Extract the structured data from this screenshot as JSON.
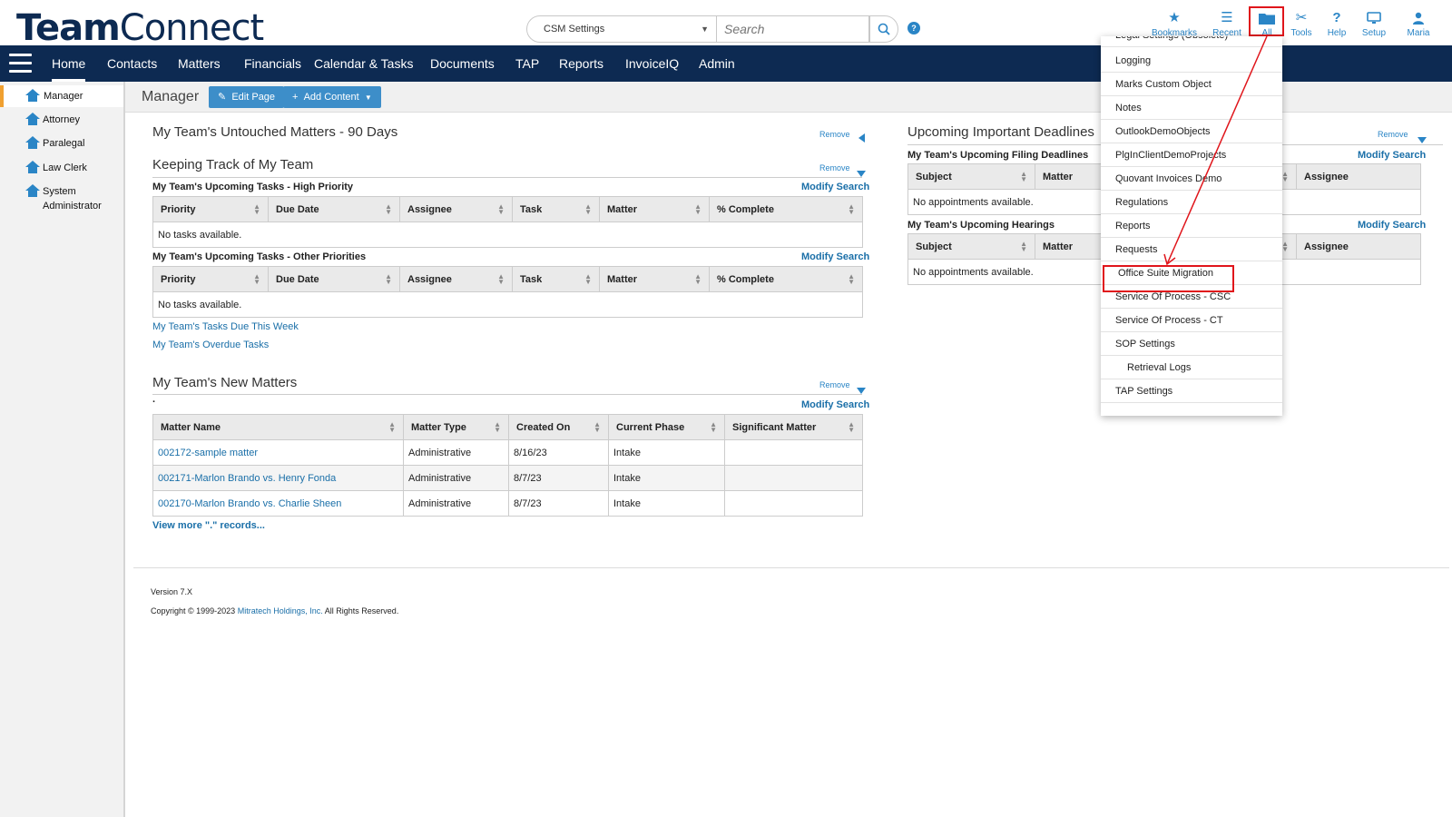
{
  "header": {
    "logo_bold": "Team",
    "logo_light": "Connect",
    "scope_select": "CSM Settings",
    "search_placeholder": "Search",
    "icons": [
      {
        "name": "bookmarks",
        "label": "Bookmarks",
        "icon": "star-icon"
      },
      {
        "name": "recent",
        "label": "Recent",
        "icon": "list-icon"
      },
      {
        "name": "all",
        "label": "All",
        "icon": "folder-icon"
      },
      {
        "name": "tools",
        "label": "Tools",
        "icon": "tools-icon"
      },
      {
        "name": "help",
        "label": "Help",
        "icon": "question-icon"
      },
      {
        "name": "setup",
        "label": "Setup",
        "icon": "monitor-icon"
      },
      {
        "name": "user",
        "label": "Maria",
        "icon": "user-icon"
      }
    ]
  },
  "nav": {
    "items": [
      "Home",
      "Contacts",
      "Matters",
      "Financials",
      "Calendar & Tasks",
      "Documents",
      "TAP",
      "Reports",
      "InvoiceIQ",
      "Admin"
    ]
  },
  "sidebar": {
    "items": [
      "Manager",
      "Attorney",
      "Paralegal",
      "Law Clerk",
      "System Administrator"
    ]
  },
  "pagebar": {
    "title": "Manager",
    "edit_label": "Edit Page",
    "add_label": "Add Content"
  },
  "left": {
    "untouched_title": "My Team's Untouched Matters - 90 Days",
    "remove": "Remove",
    "keeping_title": "Keeping Track of My Team",
    "high_title": "My Team's Upcoming Tasks - High Priority",
    "other_title": "My Team's Upcoming Tasks - Other Priorities",
    "modify": "Modify Search",
    "task_cols": [
      "Priority",
      "Due Date",
      "Assignee",
      "Task",
      "Matter",
      "% Complete"
    ],
    "no_tasks": "No tasks available.",
    "due_week": "My Team's Tasks Due This Week",
    "overdue": "My Team's Overdue Tasks",
    "new_matters_title": "My Team's New Matters",
    "dot": ".",
    "matter_cols": [
      "Matter Name",
      "Matter Type",
      "Created On",
      "Current Phase",
      "Significant Matter"
    ],
    "matters": [
      {
        "name": "002172-sample matter",
        "type": "Administrative",
        "created": "8/16/23",
        "phase": "Intake",
        "significant": ""
      },
      {
        "name": "002171-Marlon Brando vs. Henry Fonda",
        "type": "Administrative",
        "created": "8/7/23",
        "phase": "Intake",
        "significant": ""
      },
      {
        "name": "002170-Marlon Brando vs. Charlie Sheen",
        "type": "Administrative",
        "created": "8/7/23",
        "phase": "Intake",
        "significant": ""
      }
    ],
    "view_more": "View more \".\" records..."
  },
  "right": {
    "title": "Upcoming Important Deadlines",
    "remove": "Remove",
    "filing_title": "My Team's Upcoming Filing Deadlines",
    "hearings_title": "My Team's Upcoming Hearings",
    "modify": "Modify Search",
    "col_subject": "Subject",
    "col_matter": "Matter",
    "col_assignee": "Assignee",
    "no_appts": "No appointments available."
  },
  "dropdown": {
    "items": [
      {
        "label": "Legal Settings (Obsolete)",
        "sub": false
      },
      {
        "label": "Logging",
        "sub": false
      },
      {
        "label": "Marks Custom Object",
        "sub": false
      },
      {
        "label": "Notes",
        "sub": false
      },
      {
        "label": "OutlookDemoObjects",
        "sub": false
      },
      {
        "label": "PlgInClientDemoProjects",
        "sub": false
      },
      {
        "label": "Quovant Invoices Demo",
        "sub": false
      },
      {
        "label": "Regulations",
        "sub": false
      },
      {
        "label": "Reports",
        "sub": false
      },
      {
        "label": "Requests",
        "sub": false
      },
      {
        "label": "Office Suite Migration",
        "sub": false
      },
      {
        "label": "Service Of Process - CSC",
        "sub": false
      },
      {
        "label": "Service Of Process - CT",
        "sub": false
      },
      {
        "label": "SOP Settings",
        "sub": false
      },
      {
        "label": "Retrieval Logs",
        "sub": true
      },
      {
        "label": "TAP Settings",
        "sub": false
      }
    ]
  },
  "footer": {
    "version": "Version 7.X",
    "copyright_pre": "Copyright © 1999-2023",
    "company": "Mitratech Holdings, Inc.",
    "copyright_post": "All Rights Reserved."
  },
  "colors": {
    "navy": "#0d2a52",
    "accent_blue": "#2a85c6",
    "highlight_red": "#e0151b"
  }
}
